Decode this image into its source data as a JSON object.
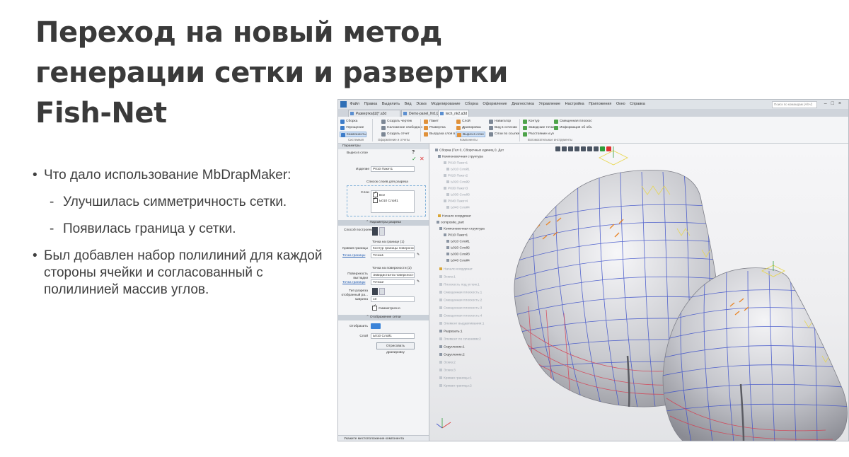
{
  "slide": {
    "title_lines": [
      "Переход на новый метод",
      "генерации сетки и развертки",
      "Fish-Net"
    ],
    "bullets": {
      "b1": "Что дало использование MbDrapMaker:",
      "s1": "Улучшилась симметричность сетки.",
      "s2": "Появилась граница у сетки.",
      "b2": "Был добавлен набор полилиний для каждой стороны ячейки и согласованный с полилинией массив углов."
    }
  },
  "app": {
    "menu": [
      "Файл",
      "Правка",
      "Выделить",
      "Вид",
      "Эскиз",
      "Моделирование",
      "Сборка",
      "Оформление",
      "Диагностика",
      "Управление",
      "Настройка",
      "Приложения",
      "Окно",
      "Справка"
    ],
    "search_placeholder": "Поиск по командам (Alt+/)",
    "tabs": [
      "Развертка(Ш)*.a3d",
      "Demo-panel_Nr1(2)...",
      "tech_nk2.a3d"
    ],
    "ribbon": {
      "col1": [
        "Сборка",
        "Упрощение",
        "Компоненты"
      ],
      "col2": [
        "Создать чертеж",
        "Наложение свободных к...",
        "Создать отчет"
      ],
      "col3": [
        "Пакет",
        "Развертка",
        "Выгрузка слоя в DXF"
      ],
      "col4": [
        "Слой",
        "Драпировка",
        "Вырез в слое"
      ],
      "col5": [
        "Навигатор",
        "Вид в сечении",
        "Слои по ссылке"
      ],
      "col6": [
        "Контур",
        "Заводские точки",
        "Расстояние и угол"
      ],
      "col7": [
        "Смещенная плоскость",
        "Информация об объекте"
      ],
      "groups": [
        "Системная",
        "Оформление и отчеты",
        "Компоненты",
        "Вспомогательные инструменты"
      ]
    },
    "panel": {
      "header": "Параметры",
      "subheader": "Вырез в слое",
      "izdelie_label": "Изделие",
      "izdelie_value": "Р010 Пакет1",
      "layers_title": "Список слоев для разреза",
      "layers_label": "Слои",
      "layer_all": "Все",
      "layer_1": "Ь010 Слой1",
      "sec_cut": "Параметры разреза",
      "method_label": "Способ построения",
      "boundary_title": "Точка на границе (1)",
      "curve_label": "Кривая границы",
      "curve_value": "Контур границы поверхности",
      "point_link1": "Точка границы",
      "point_value1": "Точка1",
      "surface_title": "Точка на поверхности (2)",
      "surface_label": "Поверхность выгладки",
      "surface_value": "Эквидистанта поверхности",
      "point_link2": "Точка границы",
      "point_value2": "Точка2",
      "type_label": "Тип разреза отобранный ра...",
      "width_label": "Ширина",
      "width_value": "10",
      "symmetry": "Симметрично",
      "sec_display": "Отображение сетки",
      "show_label": "Отобразить",
      "layer_label": "Слой",
      "layer_value": "Ь010 Слой1",
      "redraw_btn": "Отрисовать драпировку",
      "status": "Укажите местоположение компонента"
    },
    "tree": [
      "Сборка (Тел 0, Сборочных единиц 0, Дет",
      "Компоновочная структура",
      "Р010 Пакет1",
      "Ь010 Слой1",
      "Р020 Пакет2",
      "Ь020 Слой2",
      "Р030 Пакет3",
      "Ь030 Слой3",
      "Р040 Пакет4",
      "Ь040 Слой4",
      "Начало координат",
      "composite_part",
      "Компоновочная структура",
      "Р010 Пакет1",
      "Ь010 Слой1",
      "Ь020 Слой2",
      "Ь030 Слой3",
      "Ь040 Слой4",
      "Начало координат",
      "Эскиз:1",
      "Плоскость под углом:1",
      "Смещенная плоскость:1",
      "Смещенная плоскость:2",
      "Смещенная плоскость:3",
      "Смещенная плоскость:4",
      "Элемент выдавливания:1",
      "Разрезать:1",
      "Элемент по сечениям:2",
      "Скругление:1",
      "Скругление:2",
      "Эскиз:2",
      "Эскиз:3",
      "Кривая границы:1",
      "Кривая границы:2"
    ]
  },
  "colors": {
    "title": "#3a3a3a",
    "mesh_blue": "#3b4fc9",
    "mesh_red": "#d8384b",
    "mesh_yellow": "#e8d64a",
    "accent": "#3c84d8"
  }
}
